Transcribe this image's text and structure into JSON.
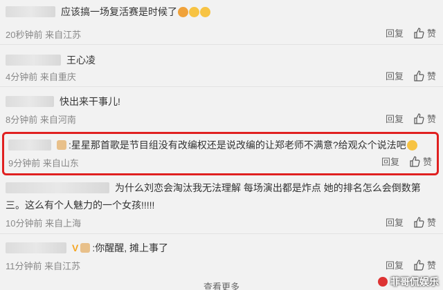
{
  "comments": [
    {
      "text": "应该搞一场复活赛是时候了",
      "time": "20秒钟前",
      "location": "来自江苏",
      "reply": "回复",
      "like": "赞"
    },
    {
      "text": "王心凌",
      "time": "4分钟前",
      "location": "来自重庆",
      "reply": "回复",
      "like": "赞"
    },
    {
      "text": "快出来干事儿!",
      "time": "8分钟前",
      "location": "来自河南",
      "reply": "回复",
      "like": "赞"
    },
    {
      "text": ":星星那首歌是节目组没有改编权还是说改编的让郑老师不满意?给观众个说法吧",
      "time": "9分钟前",
      "location": "来自山东",
      "reply": "回复",
      "like": "赞"
    },
    {
      "text": "为什么刘恋会淘汰我无法理解 每场演出都是炸点 她的排名怎么会倒数第",
      "text2": "三。这么有个人魅力的一个女孩!!!!!",
      "time": "10分钟前",
      "location": "来自上海",
      "reply": "回复",
      "like": "赞"
    },
    {
      "text": ":你醒醒, 摊上事了",
      "time": "11分钟前",
      "location": "来自江苏",
      "reply": "回复",
      "like": "赞"
    }
  ],
  "more": "查看更多",
  "watermark": "菲哥侃娱乐"
}
